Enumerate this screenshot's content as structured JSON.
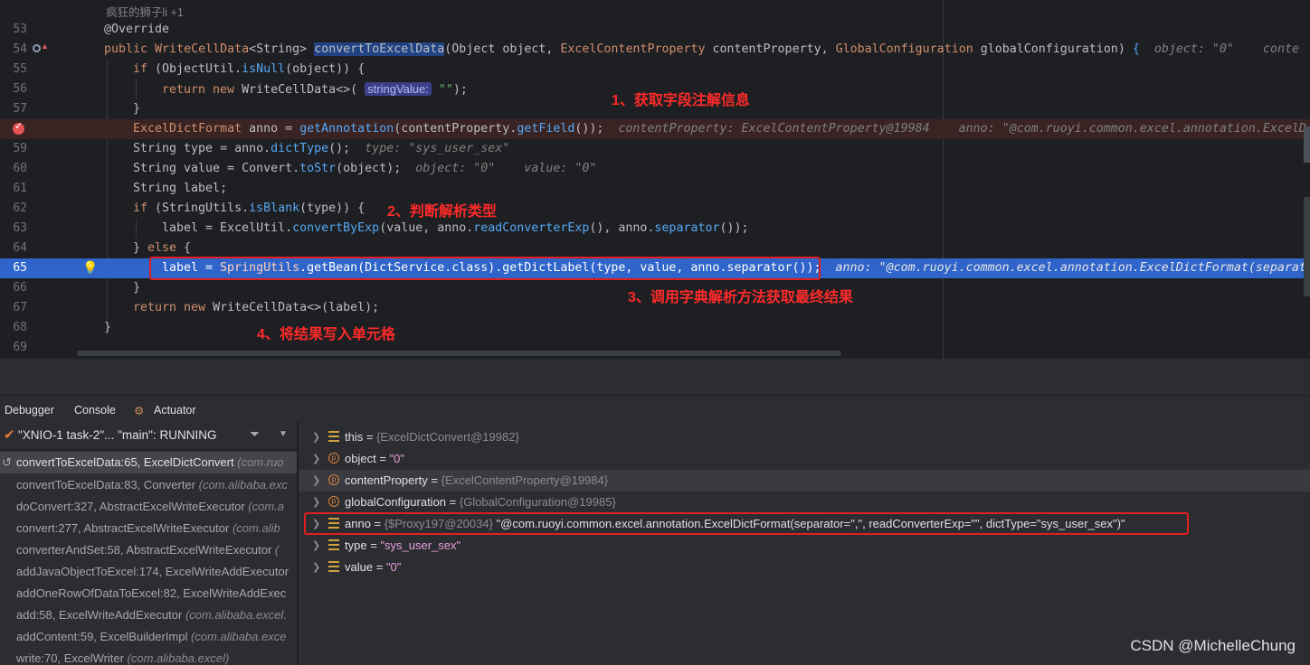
{
  "editor": {
    "author": "疯狂的狮子li +1",
    "lines": [
      {
        "num": "53",
        "text": "@Override"
      },
      {
        "num": "54",
        "text": "public WriteCellData<String> convertToExcelData(Object object, ExcelContentProperty contentProperty, GlobalConfiguration globalConfiguration) {",
        "hint": "object: \"0\"    conte"
      },
      {
        "num": "55",
        "text": "if (ObjectUtil.isNull(object)) {"
      },
      {
        "num": "56",
        "text": "return new WriteCellData<>(",
        "inlay": "stringValue:",
        "tail": "\"\");"
      },
      {
        "num": "57",
        "text": "}"
      },
      {
        "num": "58",
        "text": "ExcelDictFormat anno = getAnnotation(contentProperty.getField());",
        "hint": "contentProperty: ExcelContentProperty@19984    anno: \"@com.ruoyi.common.excel.annotation.ExcelD"
      },
      {
        "num": "59",
        "text": "String type = anno.dictType();",
        "hint": "type: \"sys_user_sex\""
      },
      {
        "num": "60",
        "text": "String value = Convert.toStr(object);",
        "hint": "object: \"0\"    value: \"0\""
      },
      {
        "num": "61",
        "text": "String label;"
      },
      {
        "num": "62",
        "text": "if (StringUtils.isBlank(type)) {"
      },
      {
        "num": "63",
        "text": "label = ExcelUtil.convertByExp(value, anno.readConverterExp(), anno.separator());"
      },
      {
        "num": "64",
        "text": "} else {"
      },
      {
        "num": "65",
        "text": "label = SpringUtils.getBean(DictService.class).getDictLabel(type, value, anno.separator());",
        "hint": "anno: \"@com.ruoyi.common.excel.annotation.ExcelDictFormat(separat"
      },
      {
        "num": "66",
        "text": "}"
      },
      {
        "num": "67",
        "text": "return new WriteCellData<>(label);"
      },
      {
        "num": "68",
        "text": "}"
      },
      {
        "num": "69",
        "text": ""
      }
    ],
    "annotations": [
      "1、获取字段注解信息",
      "2、判断解析类型",
      "3、调用字典解析方法获取最终结果",
      "4、将结果写入单元格"
    ]
  },
  "debugger": {
    "tabs": [
      "Debugger",
      "Console",
      "Actuator"
    ],
    "thread": "\"XNIO-1 task-2\"... \"main\": RUNNING",
    "frames": [
      {
        "method": "convertToExcelData:65, ExcelDictConvert",
        "pkg": "(com.ruo"
      },
      {
        "method": "convertToExcelData:83, Converter",
        "pkg": "(com.alibaba.exc"
      },
      {
        "method": "doConvert:327, AbstractExcelWriteExecutor",
        "pkg": "(com.a"
      },
      {
        "method": "convert:277, AbstractExcelWriteExecutor",
        "pkg": "(com.alib"
      },
      {
        "method": "converterAndSet:58, AbstractExcelWriteExecutor",
        "pkg": "("
      },
      {
        "method": "addJavaObjectToExcel:174, ExcelWriteAddExecutor",
        "pkg": ""
      },
      {
        "method": "addOneRowOfDataToExcel:82, ExcelWriteAddExec",
        "pkg": ""
      },
      {
        "method": "add:58, ExcelWriteAddExecutor",
        "pkg": "(com.alibaba.excel."
      },
      {
        "method": "addContent:59, ExcelBuilderImpl",
        "pkg": "(com.alibaba.exce"
      },
      {
        "method": "write:70, ExcelWriter",
        "pkg": "(com.alibaba.excel)"
      }
    ],
    "variables": [
      {
        "icon": "field",
        "name": "this",
        "ref": "{ExcelDictConvert@19982}",
        "value": ""
      },
      {
        "icon": "param",
        "name": "object",
        "ref": "",
        "value": "\"0\""
      },
      {
        "icon": "param",
        "name": "contentProperty",
        "ref": "{ExcelContentProperty@19984}",
        "value": ""
      },
      {
        "icon": "param",
        "name": "globalConfiguration",
        "ref": "{GlobalConfiguration@19985}",
        "value": ""
      },
      {
        "icon": "field",
        "name": "anno",
        "ref": "{$Proxy197@20034}",
        "value": "\"@com.ruoyi.common.excel.annotation.ExcelDictFormat(separator=\",\", readConverterExp=\"\", dictType=\"sys_user_sex\")\""
      },
      {
        "icon": "field",
        "name": "type",
        "ref": "",
        "value": "\"sys_user_sex\""
      },
      {
        "icon": "field",
        "name": "value",
        "ref": "",
        "value": "\"0\""
      }
    ]
  },
  "watermark": "CSDN @MichelleChung"
}
